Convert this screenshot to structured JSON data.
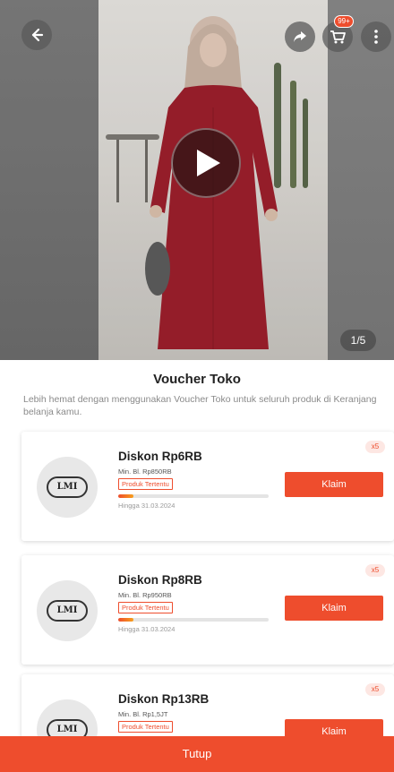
{
  "media": {
    "counter": "1/5",
    "cart_badge": "99+"
  },
  "sheet": {
    "title": "Voucher Toko",
    "description": "Lebih hemat dengan menggunakan Voucher Toko untuk seluruh produk di Keranjang belanja kamu."
  },
  "vouchers": [
    {
      "logo_text": "LMI",
      "title": "Diskon Rp6RB",
      "min_spend": "Min. Bl. Rp850RB",
      "tag": "Produk Tertentu",
      "progress": 0.1,
      "until": "Hingga 31.03.2024",
      "quantity": "x5",
      "claim_label": "Klaim"
    },
    {
      "logo_text": "LMI",
      "title": "Diskon Rp8RB",
      "min_spend": "Min. Bl. Rp950RB",
      "tag": "Produk Tertentu",
      "progress": 0.1,
      "until": "Hingga 31.03.2024",
      "quantity": "x5",
      "claim_label": "Klaim"
    },
    {
      "logo_text": "LMI",
      "title": "Diskon Rp13RB",
      "min_spend": "Min. Bl. Rp1,5JT",
      "tag": "Produk Tertentu",
      "quantity": "x5",
      "claim_label": "Klaim"
    }
  ],
  "footer": {
    "close_label": "Tutup"
  },
  "colors": {
    "accent": "#ee4d2d",
    "dress": "#9e1f2c"
  }
}
